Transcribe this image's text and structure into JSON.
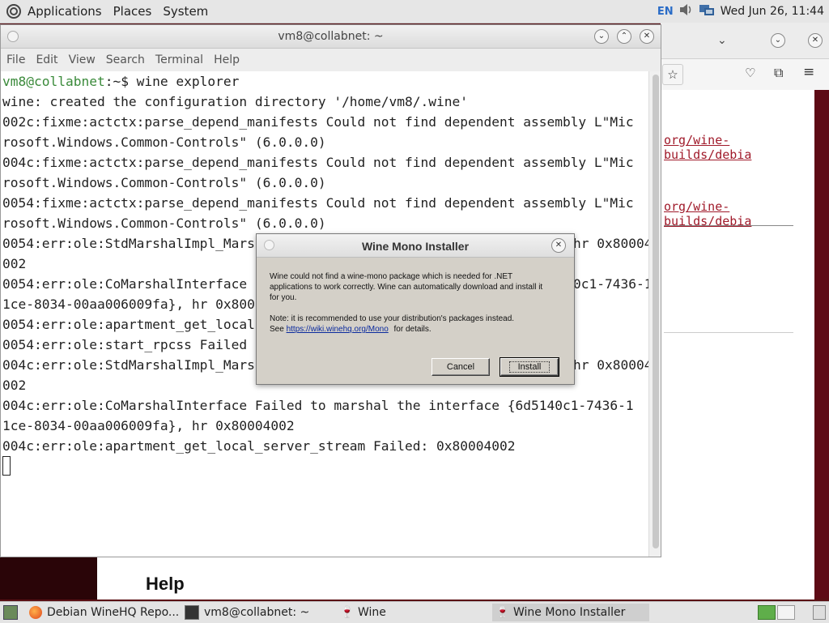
{
  "top_panel": {
    "menus": [
      "Applications",
      "Places",
      "System"
    ],
    "keyboard_layout": "EN",
    "clock": "Wed Jun 26, 11:44"
  },
  "browser_bg": {
    "links": [
      "org/wine-builds/debia",
      "org/wine-builds/debia"
    ],
    "heading": "Help"
  },
  "terminal": {
    "title": "vm8@collabnet: ~",
    "menus": [
      "File",
      "Edit",
      "View",
      "Search",
      "Terminal",
      "Help"
    ],
    "prompt_user": "vm8@collabnet",
    "prompt_rest": ":~$ wine explorer",
    "lines": [
      "wine: created the configuration directory '/home/vm8/.wine'",
      "002c:fixme:actctx:parse_depend_manifests Could not find dependent assembly L\"Mic",
      "rosoft.Windows.Common-Controls\" (6.0.0.0)",
      "004c:fixme:actctx:parse_depend_manifests Could not find dependent assembly L\"Mic",
      "rosoft.Windows.Common-Controls\" (6.0.0.0)",
      "0054:fixme:actctx:parse_depend_manifests Could not find dependent assembly L\"Mic",
      "rosoft.Windows.Common-Controls\" (6.0.0.0)",
      "0054:err:ole:StdMarshalImpl_Mars",
      "002",
      "0054:err:ole:CoMarshalInterface",
      "1ce-8034-00aa006009fa}, hr 0x800",
      "0054:err:ole:apartment_get_local",
      "0054:err:ole:start_rpcss Failed",
      "004c:err:ole:StdMarshalImpl_Mars",
      "002",
      "004c:err:ole:CoMarshalInterface Failed to marshal the interface {6d5140c1-7436-1",
      "1ce-8034-00aa006009fa}, hr 0x80004002",
      "004c:err:ole:apartment_get_local_server_stream Failed: 0x80004002"
    ],
    "right_fragments": {
      "line8": "hr 0x80004",
      "line10": "0c1-7436-1",
      "line14": "hr 0x80004"
    }
  },
  "dialog": {
    "title": "Wine Mono Installer",
    "message": "Wine could not find a wine-mono package which is needed for .NET applications to work correctly. Wine can automatically download and install it for you.",
    "note_prefix": "Note: it is recommended to use your distribution's packages instead.",
    "see": "See",
    "url": "https://wiki.winehq.org/Mono",
    "for_details": "for details.",
    "cancel_label": "Cancel",
    "install_label": "Install"
  },
  "taskbar": {
    "items": [
      {
        "label": "Debian WineHQ Repo..."
      },
      {
        "label": "vm8@collabnet: ~"
      },
      {
        "label": "Wine"
      },
      {
        "label": "Wine Mono Installer"
      }
    ]
  }
}
